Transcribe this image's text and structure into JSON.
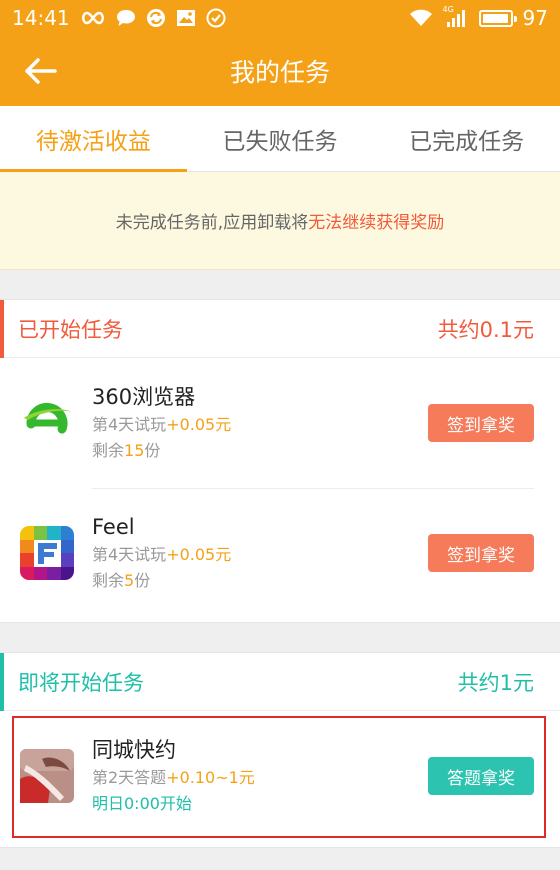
{
  "status_bar": {
    "time": "14:41",
    "battery": "97",
    "battery_level_percent": 97,
    "icons_left": [
      "infinity-icon",
      "chat-bubble-icon",
      "sync-icon",
      "image-icon",
      "check-circle-icon"
    ],
    "icons_right": [
      "wifi-icon",
      "signal-4g-icon",
      "battery-icon"
    ],
    "network_label": "4G"
  },
  "header": {
    "title": "我的任务",
    "back_icon": "back-arrow-icon"
  },
  "tabs": [
    {
      "label": "待激活收益",
      "active": true
    },
    {
      "label": "已失败任务",
      "active": false
    },
    {
      "label": "已完成任务",
      "active": false
    }
  ],
  "notice": {
    "prefix": "未完成任务前,应用卸载将",
    "highlight": "无法继续获得奖励"
  },
  "started_section": {
    "title": "已开始任务",
    "total": "共约0.1元",
    "tasks": [
      {
        "name": "360浏览器",
        "icon": "360-browser-icon",
        "day_text": "第4天试玩",
        "reward": "+0.05元",
        "remain_prefix": "剩余",
        "remain_count": "15",
        "remain_suffix": "份",
        "button": "签到拿奖"
      },
      {
        "name": "Feel",
        "icon": "feel-app-icon",
        "day_text": "第4天试玩",
        "reward": "+0.05元",
        "remain_prefix": "剩余",
        "remain_count": "5",
        "remain_suffix": "份",
        "button": "签到拿奖"
      }
    ]
  },
  "upcoming_section": {
    "title": "即将开始任务",
    "total": "共约1元",
    "tasks": [
      {
        "name": "同城快约",
        "icon": "tongcheng-kuaiyue-icon",
        "day_text": "第2天答题",
        "reward": "+0.10~1元",
        "start_text": "明日0:00开始",
        "button": "答题拿奖"
      }
    ]
  },
  "colors": {
    "brand": "#f5a117",
    "accent_red": "#f15a3b",
    "teal": "#1fbfa8",
    "button_orange": "#f57b5a",
    "button_teal": "#2cc3b0",
    "highlight_box": "#e02a2a"
  }
}
